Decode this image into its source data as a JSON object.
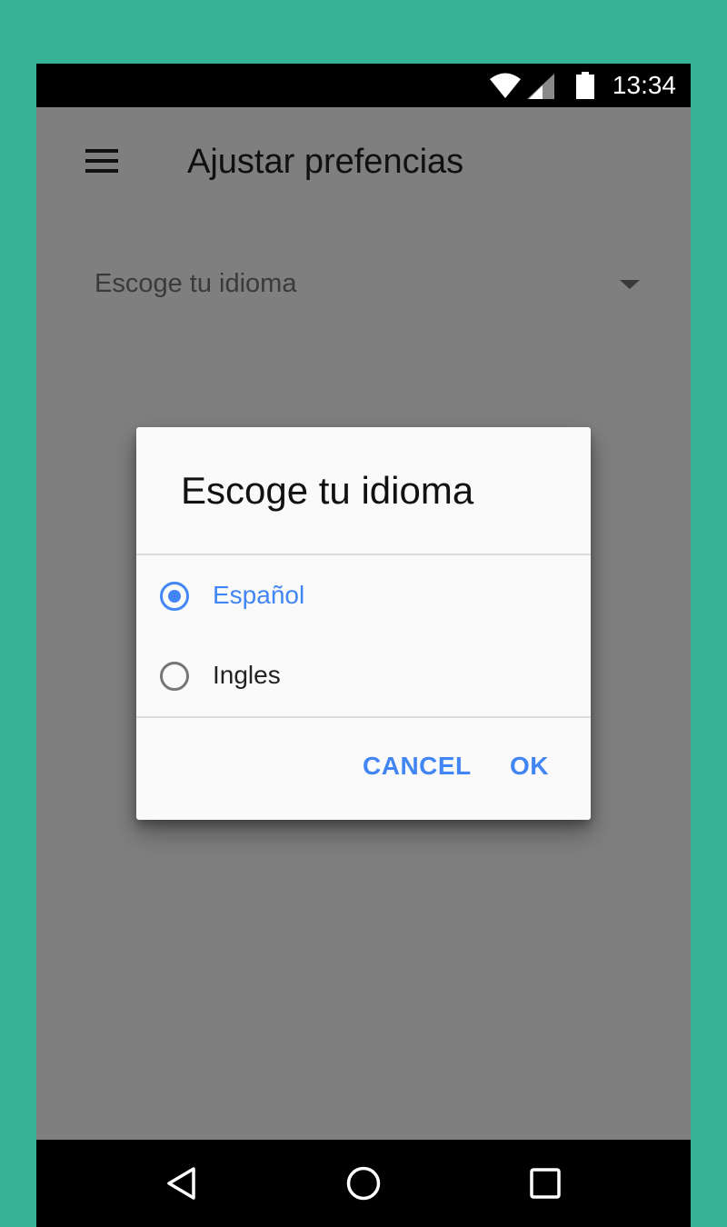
{
  "status_bar": {
    "time": "13:34",
    "icons": [
      "wifi-icon",
      "cellular-signal-icon",
      "battery-icon"
    ]
  },
  "app_bar": {
    "menu_icon": "hamburger-menu-icon",
    "title": "Ajustar prefencias"
  },
  "preferences": {
    "language_dropdown_label": "Escoge tu idioma",
    "dropdown_icon": "dropdown-arrow-icon"
  },
  "dialog": {
    "title": "Escoge tu idioma",
    "options": [
      {
        "label": "Español",
        "selected": true
      },
      {
        "label": "Ingles",
        "selected": false
      }
    ],
    "cancel_label": "CANCEL",
    "ok_label": "OK"
  },
  "nav_bar": {
    "icons": [
      "back-icon",
      "home-icon",
      "recents-icon"
    ]
  },
  "colors": {
    "background": "#36b397",
    "accent": "#4285f4",
    "scrim": "rgba(0,0,0,0.5)"
  }
}
